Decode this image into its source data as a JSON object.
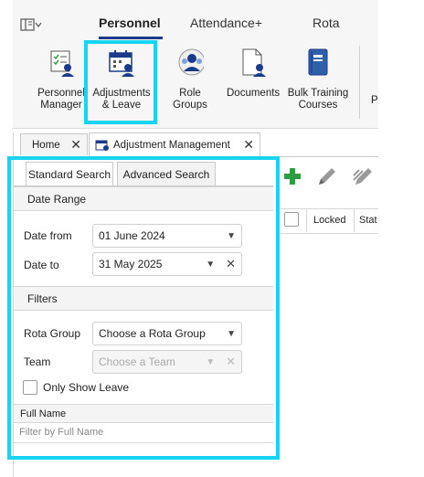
{
  "ribbon_tabs": {
    "personnel": "Personnel",
    "attendance": "Attendance+",
    "rota": "Rota"
  },
  "ribbon_buttons": {
    "personnel_manager": [
      "Personnel",
      "Manager"
    ],
    "adjustments_leave": [
      "Adjustments",
      "& Leave"
    ],
    "role_groups": "Role Groups",
    "documents": "Documents",
    "bulk_training": [
      "Bulk Training",
      "Courses"
    ],
    "cut_off": "P"
  },
  "doc_tabs": {
    "home": "Home",
    "adjustment_management": "Adjustment Management"
  },
  "search_tabs": {
    "standard": "Standard Search",
    "advanced": "Advanced Search"
  },
  "date_range": {
    "title": "Date Range",
    "from_label": "Date from",
    "from_value": "01 June 2024",
    "to_label": "Date to",
    "to_value": "31 May 2025"
  },
  "filters": {
    "title": "Filters",
    "rota_group_label": "Rota Group",
    "rota_group_value": "Choose a Rota Group",
    "team_label": "Team",
    "team_value": "Choose a Team",
    "only_leave_label": "Only Show Leave"
  },
  "full_name": {
    "label": "Full Name",
    "placeholder": "Filter by Full Name"
  },
  "grid": {
    "col_locked": "Locked",
    "col_status": "Stat"
  },
  "colors": {
    "highlight": "#17d4f0",
    "accent_underline": "#1a3a8a",
    "add_green": "#2e9e44"
  }
}
